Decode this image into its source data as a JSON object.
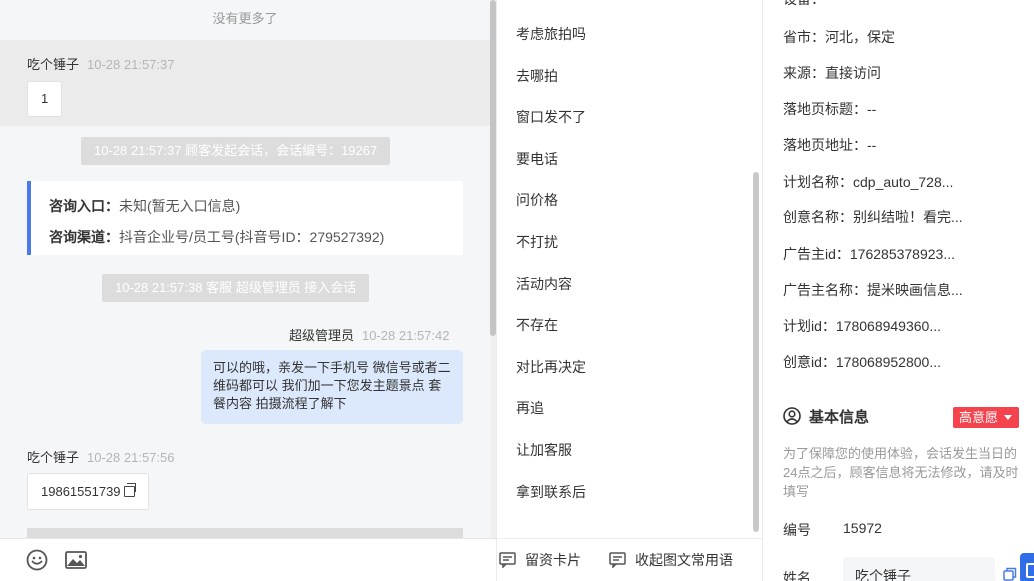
{
  "chat": {
    "no_more": "没有更多了",
    "messages": [
      {
        "sender": "吃个锤子",
        "time": "10-28 21:57:37",
        "text": "1"
      }
    ],
    "system_start": "10-28 21:57:37 顾客发起会话，会话编号：19267",
    "entry_card": {
      "entry_label": "咨询入口：",
      "entry_value": "未知(暂无入口信息)",
      "channel_label": "咨询渠道：",
      "channel_value": "抖音企业号/员工号(抖音号ID：279527392)"
    },
    "system_join": "10-28 21:57:38 客服 超级管理员 接入会话",
    "agent_message": {
      "sender": "超级管理员",
      "time": "10-28 21:57:42",
      "text": "可以的哦，亲发一下手机号 微信号或者二维码都可以 我们加一下您发主题景点 套餐内容 拍摄流程了解下"
    },
    "customer_message2": {
      "sender": "吃个锤子",
      "time": "10-28 21:57:56",
      "text": "19861551739"
    }
  },
  "toolbar": {
    "emoji_icon": "smiley-icon",
    "image_icon": "image-icon"
  },
  "quick_replies": {
    "items": [
      "考虑旅拍吗",
      "去哪拍",
      "窗口发不了",
      "要电话",
      "问价格",
      "不打扰",
      "活动内容",
      "不存在",
      "对比再决定",
      "再追",
      "让加客服",
      "拿到联系后"
    ],
    "footer_card": "留资卡片",
    "footer_collect": "收起图文常用语"
  },
  "customer": {
    "device_partial": "设备：",
    "region": "省市：河北，保定",
    "source": "来源：直接访问",
    "landing_title": "落地页标题：--",
    "landing_url": "落地页地址：--",
    "plan_name": "计划名称：cdp_auto_728...",
    "creative_name": "创意名称：别纠结啦！看完...",
    "advertiser_id": "广告主id：176285378923...",
    "advertiser_name": "广告主名称：提米映画信息...",
    "plan_id": "计划id：178068949360...",
    "creative_id": "创意id：178068952800...",
    "basic_title": "基本信息",
    "intent_badge": "高意愿",
    "notice": "为了保障您的使用体验，会话发生当日的24点之后，顾客信息将无法修改，请及时填写",
    "number_label": "编号",
    "number_value": "15972",
    "name_label": "姓名",
    "name_value": "吃个锤子"
  }
}
